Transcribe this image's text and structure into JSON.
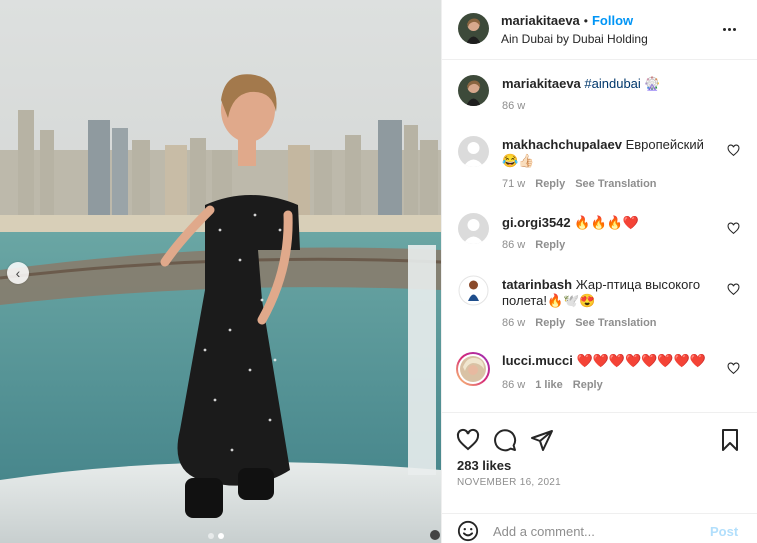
{
  "post": {
    "username": "mariakitaeva",
    "follow_label": "Follow",
    "location": "Ain Dubai by Dubai Holding",
    "more_label": "More options"
  },
  "caption": {
    "username": "mariakitaeva",
    "hashtag": "#aindubai",
    "emoji": "🎡",
    "time": "86 w"
  },
  "comments": [
    {
      "username": "makhachchupalaev",
      "text": "Европейский 😂👍🏻",
      "time": "71 w",
      "likes": "",
      "reply_label": "Reply",
      "translate_label": "See Translation",
      "avatar_type": "default"
    },
    {
      "username": "gi.orgi3542",
      "text": "🔥🔥🔥❤️",
      "time": "86 w",
      "likes": "",
      "reply_label": "Reply",
      "translate_label": "",
      "avatar_type": "default"
    },
    {
      "username": "tatarinbash",
      "text": "Жар-птица высокого полета!🔥🕊️😍",
      "time": "86 w",
      "likes": "",
      "reply_label": "Reply",
      "translate_label": "See Translation",
      "avatar_type": "mini"
    },
    {
      "username": "lucci.mucci",
      "text": "❤️❤️❤️❤️❤️❤️❤️❤️",
      "time": "86 w",
      "likes": "1 like",
      "reply_label": "Reply",
      "translate_label": "",
      "avatar_type": "story"
    }
  ],
  "actions": {
    "likes": "283 likes",
    "date": "NOVEMBER 16, 2021"
  },
  "add_comment": {
    "placeholder": "Add a comment...",
    "post_label": "Post"
  },
  "carousel": {
    "prev_glyph": "‹"
  },
  "colors": {
    "follow": "#0095f6",
    "hashtag": "#00376b",
    "muted": "#8e8e8e",
    "post_disabled": "#b2dffc",
    "heart_red": "#ed4956"
  }
}
